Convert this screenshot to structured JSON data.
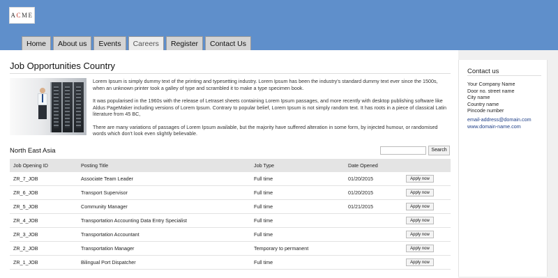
{
  "logo": {
    "text_before": "A",
    "text_mark": "C",
    "text_after": "ME"
  },
  "nav": [
    {
      "label": "Home",
      "active": false
    },
    {
      "label": "About us",
      "active": false
    },
    {
      "label": "Events",
      "active": false
    },
    {
      "label": "Careers",
      "active": true
    },
    {
      "label": "Register",
      "active": false
    },
    {
      "label": "Contact Us",
      "active": false
    }
  ],
  "page": {
    "title": "Job Opportunities Country",
    "paragraphs": [
      "Lorem Ipsum is simply dummy text of the printing and typesetting industry. Lorem Ipsum has been the industry's standard dummy text ever since the 1500s, when an unknown printer took a galley of type and scrambled it to make a type specimen book.",
      "It was popularised in the 1960s with the release of Letraset sheets containing Lorem Ipsum passages, and more recently with desktop publishing software like Aldus PageMaker including versions of Lorem Ipsum. Contrary to popular belief, Lorem Ipsum is not simply random text. It has roots in a piece of classical Latin literature from 45 BC,",
      "There are many variations of passages of Lorem Ipsum available, but the majority have suffered alteration in some form, by injected humour, or randomised words which don't look even slightly believable."
    ],
    "region": "North East Asia",
    "search": {
      "value": "",
      "button_label": "Search"
    }
  },
  "table": {
    "columns": [
      "Job Opening ID",
      "Posting Title",
      "Job Type",
      "Date Opened",
      ""
    ],
    "apply_label": "Apply now",
    "rows": [
      {
        "id": "ZR_7_JOB",
        "title": "Associate Team Leader",
        "type": "Full time",
        "date": "01/20/2015"
      },
      {
        "id": "ZR_6_JOB",
        "title": "Transport Supervisor",
        "type": "Full time",
        "date": "01/20/2015"
      },
      {
        "id": "ZR_5_JOB",
        "title": "Community Manager",
        "type": "Full time",
        "date": "01/21/2015"
      },
      {
        "id": "ZR_4_JOB",
        "title": "Transportation Accounting Data Entry Specialist",
        "type": "Full time",
        "date": ""
      },
      {
        "id": "ZR_3_JOB",
        "title": "Transportation Accountant",
        "type": "Full time",
        "date": ""
      },
      {
        "id": "ZR_2_JOB",
        "title": "Transportation Manager",
        "type": "Temporary to permanent",
        "date": ""
      },
      {
        "id": "ZR_1_JOB",
        "title": "Bilingual Port Dispatcher",
        "type": "Full time",
        "date": ""
      }
    ]
  },
  "sidebar": {
    "heading": "Contact us",
    "address": [
      "Your Company Name",
      "Door no. street name",
      "City name",
      "Country name",
      "Pincode number"
    ],
    "email": "email-address@domain.com",
    "website": "www.domain-name.com"
  },
  "colors": {
    "header": "#5f8fcb",
    "logo_mark": "#c0392b",
    "link": "#1e3f88"
  },
  "icons": {
    "hero_image": "server-room-photo"
  }
}
